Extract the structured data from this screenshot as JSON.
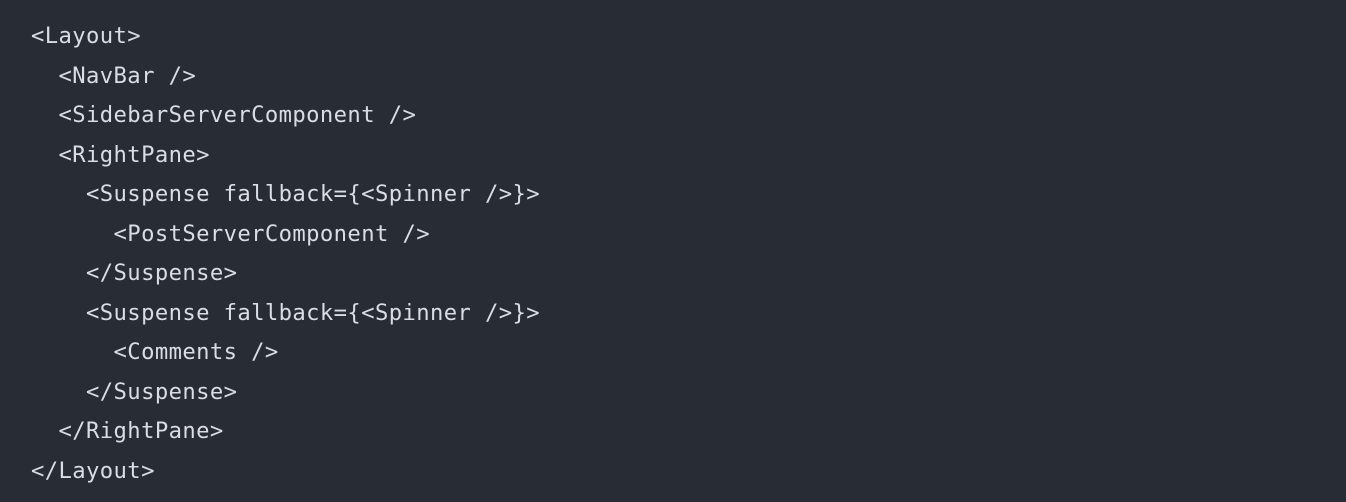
{
  "code": {
    "lines": [
      "<Layout>",
      "  <NavBar />",
      "  <SidebarServerComponent />",
      "  <RightPane>",
      "    <Suspense fallback={<Spinner />}>",
      "      <PostServerComponent />",
      "    </Suspense>",
      "    <Suspense fallback={<Spinner />}>",
      "      <Comments />",
      "    </Suspense>",
      "  </RightPane>",
      "</Layout>"
    ]
  },
  "colors": {
    "background": "#282c34",
    "text": "#dadde3"
  }
}
